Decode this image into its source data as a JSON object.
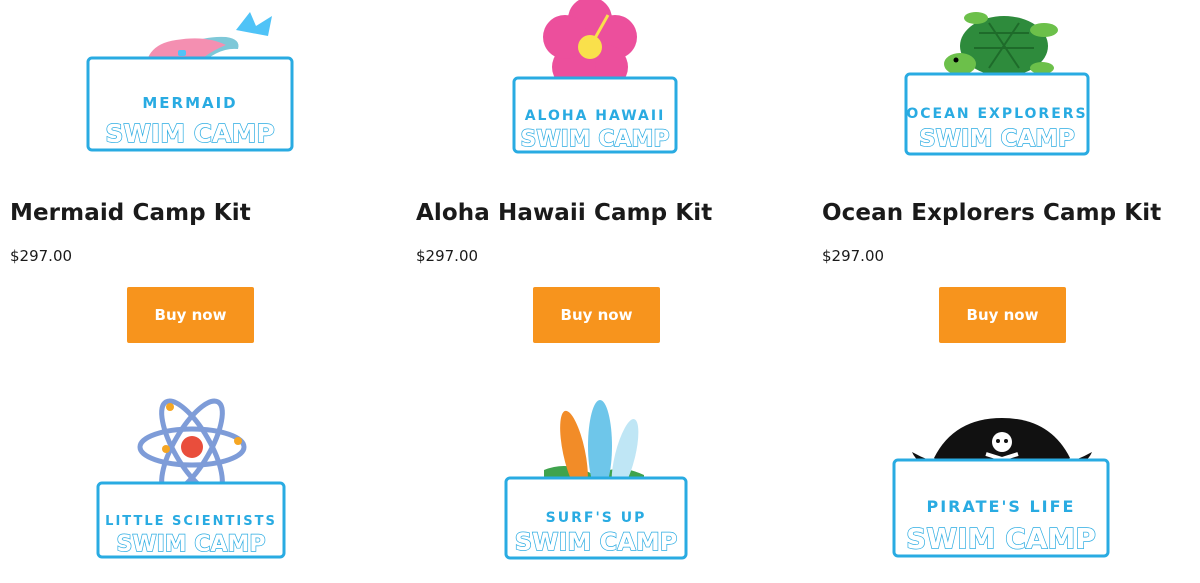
{
  "products": [
    {
      "title": "Mermaid Camp Kit",
      "price": "$297.00",
      "button": "Buy now",
      "logo_line1": "MERMAID",
      "logo_line2": "SWIM CAMP",
      "icon": "mermaid-icon"
    },
    {
      "title": "Aloha Hawaii Camp Kit",
      "price": "$297.00",
      "button": "Buy now",
      "logo_line1": "ALOHA HAWAII",
      "logo_line2": "SWIM CAMP",
      "icon": "hibiscus-icon"
    },
    {
      "title": "Ocean Explorers Camp Kit",
      "price": "$297.00",
      "button": "Buy now",
      "logo_line1": "OCEAN EXPLORERS",
      "logo_line2": "SWIM CAMP",
      "icon": "sea-turtle-icon"
    },
    {
      "logo_line1": "LITTLE SCIENTISTS",
      "logo_line2": "SWIM CAMP",
      "icon": "atom-icon"
    },
    {
      "logo_line1": "SURF'S UP",
      "logo_line2": "SWIM CAMP",
      "icon": "surfboards-icon"
    },
    {
      "logo_line1": "PIRATE'S LIFE",
      "logo_line2": "SWIM CAMP",
      "icon": "pirate-hat-icon"
    }
  ],
  "colors": {
    "button": "#f7941d",
    "logo_blue": "#29abe2",
    "text": "#1a1a1a"
  }
}
